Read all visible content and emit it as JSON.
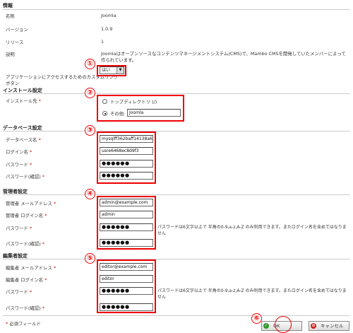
{
  "info": {
    "heading": "情報",
    "name_label": "名称",
    "name_value": "Joomla",
    "version_label": "バージョン",
    "version_value": "1.0.9",
    "release_label": "リリース",
    "release_value": "1",
    "desc_label": "説明",
    "desc_value": "Joomlaはオープンソースなコンテンツマネージメントシステム(CMS)で、Mambo CMSを開発していたメンバーによって作られています。",
    "access_label": "アプリケーションにアクセスするためのカスタムリンク",
    "access_label2": "ボタン",
    "access_value": "はい"
  },
  "install": {
    "heading": "インストール設定",
    "target_label": "インストール先",
    "opt_top": "トップディレクトリ (/)",
    "opt_other": "その他:",
    "other_value": "Joomla"
  },
  "database": {
    "heading": "データベース設定",
    "dbname_label": "データベース名",
    "dbname_value": "mysqlff362baff14138a6",
    "login_label": "ログイン名",
    "login_value": "usre6468ec8d9f3",
    "pw_label": "パスワード",
    "pw_value": "●●●●●●",
    "pw2_label": "パスワード(確認)",
    "pw2_value": "●●●●●●"
  },
  "admin": {
    "heading": "管理者設定",
    "email_label": "管理者 メールアドレス",
    "email_value": "admin@example.com",
    "login_label": "管理者 ログイン名",
    "login_value": "admin",
    "pw_label": "パスワード",
    "pw_value": "●●●●●●",
    "pw2_label": "パスワード(確認)",
    "pw2_value": "●●●●●●",
    "hint": "パスワードは6文字以上で 半角の0-9,a-z,A-Z のみ利用できます。またログイン名を含めてはなりません"
  },
  "editor": {
    "heading": "編集者設定",
    "email_label": "編集者 メールアドレス",
    "email_value": "editor@example.com",
    "login_label": "編集者 ログイン名",
    "login_value": "editor",
    "pw_label": "パスワード",
    "pw_value": "●●●●●●",
    "pw2_label": "パスワード(確認)",
    "pw2_value": "●●●●●●",
    "hint": "パスワードは6文字以上で 半角の0-9,a-z,A-Z のみ利用できます。またログイン名を含めてはなりません"
  },
  "footer": {
    "required_note": "必須フィールド",
    "ok_label": "OK",
    "cancel_label": "キャンセル"
  },
  "markers": [
    "①",
    "②",
    "③",
    "④",
    "⑤",
    "⑥"
  ],
  "colors": {
    "highlight": "#ee0000",
    "required": "#cc0000",
    "ok_icon": "#2a9a2a",
    "cancel_icon": "#d02020"
  }
}
